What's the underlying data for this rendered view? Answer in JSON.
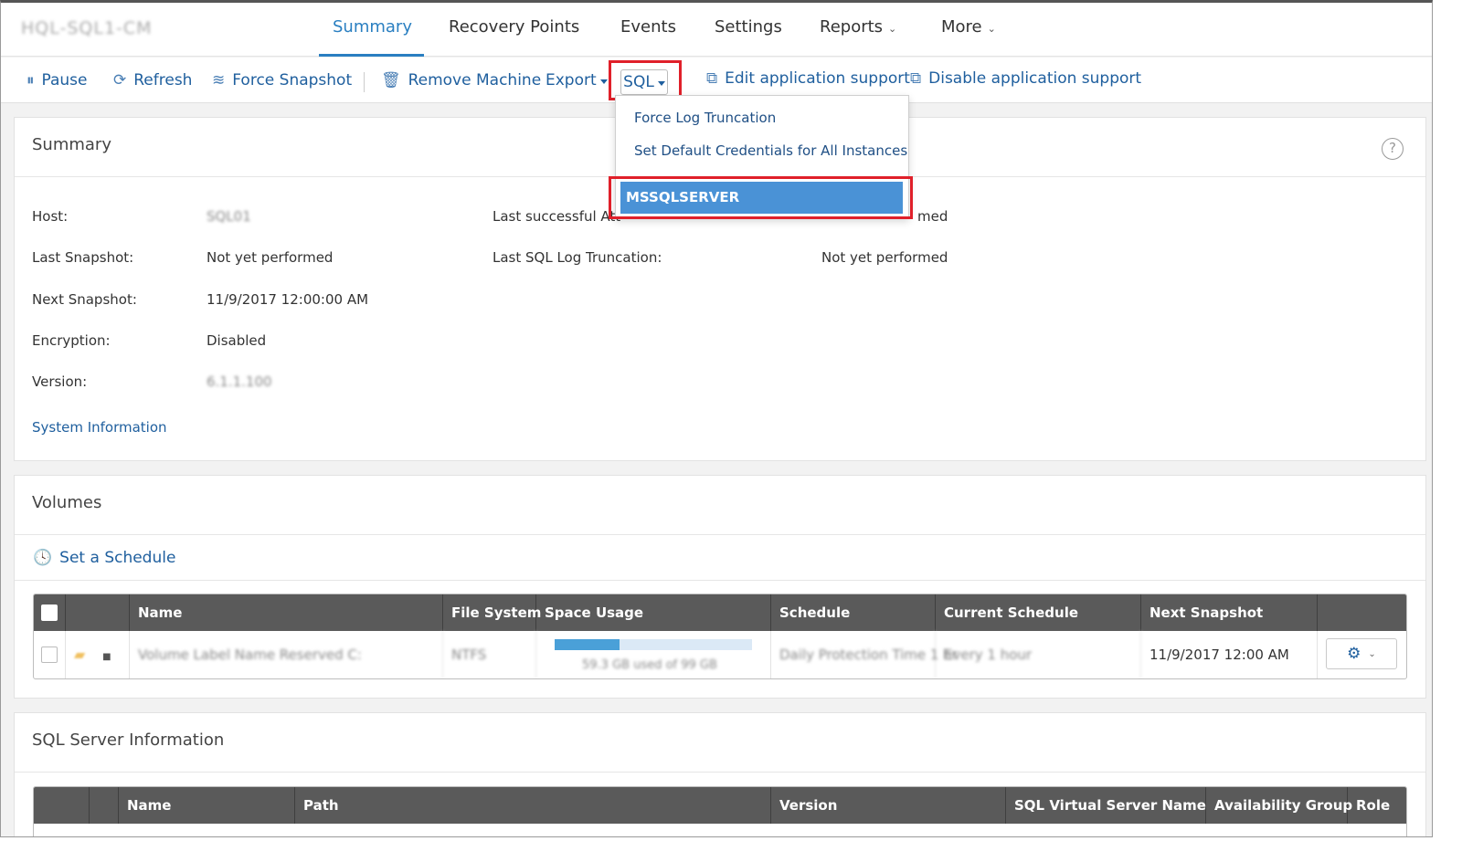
{
  "header": {
    "machine_name": "HQL-SQL1-CM",
    "tabs": [
      {
        "label": "Summary",
        "active": true
      },
      {
        "label": "Recovery Points"
      },
      {
        "label": "Events"
      },
      {
        "label": "Settings"
      },
      {
        "label": "Reports"
      },
      {
        "label": "More"
      }
    ]
  },
  "toolbar": {
    "pause": "Pause",
    "refresh": "Refresh",
    "force_snapshot": "Force Snapshot",
    "remove_machine": "Remove Machine",
    "export": "Export",
    "sql": "SQL",
    "edit_app_support": "Edit application support",
    "disable_app_support": "Disable application support"
  },
  "sql_menu": {
    "items": [
      "Force Log Truncation",
      "Set Default Credentials for All Instances"
    ],
    "instance": "MSSQLSERVER"
  },
  "summary": {
    "title": "Summary",
    "help": "?",
    "rows": [
      {
        "label": "Host:",
        "value": "SQL01"
      },
      {
        "label": "Last Snapshot:",
        "value": "Not yet performed"
      },
      {
        "label": "Next Snapshot:",
        "value": "11/9/2017 12:00:00 AM"
      },
      {
        "label": "Encryption:",
        "value": "Disabled"
      },
      {
        "label": "Version:",
        "value": "6.1.1.100"
      }
    ],
    "right_rows": [
      {
        "label": "Last successful Att",
        "value": "med"
      },
      {
        "label": "Last SQL Log Truncation:",
        "value": "Not yet performed"
      }
    ],
    "system_info_link": "System Information"
  },
  "volumes": {
    "title": "Volumes",
    "set_schedule": "Set a Schedule",
    "columns": [
      "Name",
      "File System",
      "Space Usage",
      "Schedule",
      "Current Schedule",
      "Next Snapshot"
    ],
    "row": {
      "name": "Volume Label Name Reserved C:",
      "file_system": "NTFS",
      "space_usage_text": "59.3 GB used of 99 GB",
      "space_usage_fraction": 0.33,
      "schedule": "Daily Protection Time 1 hr",
      "current_schedule": "Every 1 hour",
      "next_snapshot": "11/9/2017 12:00 AM"
    }
  },
  "sql_info": {
    "title": "SQL Server Information",
    "columns": [
      "Name",
      "Path",
      "Version",
      "SQL Virtual Server Name",
      "Availability Group",
      "Role"
    ]
  },
  "colors": {
    "accent": "#2a7fc1",
    "highlight": "#e0202a",
    "selected": "#4a92d6",
    "table_header": "#5a5a5a"
  }
}
